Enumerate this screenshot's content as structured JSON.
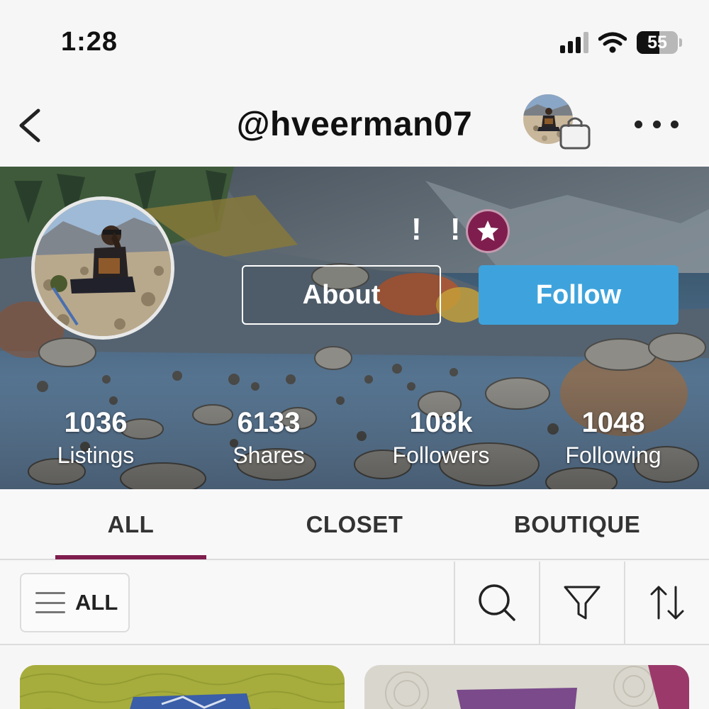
{
  "status_bar": {
    "time": "1:28",
    "battery_level": "55",
    "signal_bars_active": 3,
    "signal_bars_total": 4
  },
  "header": {
    "username": "@hveerman07",
    "icons": {
      "back": "chevron-left-icon",
      "bag": "shopping-bag-icon",
      "more": "more-horizontal-icon"
    }
  },
  "profile": {
    "exclamation_marks": "! !",
    "badge_icon": "star-icon",
    "about_label": "About",
    "follow_label": "Follow",
    "stats": [
      {
        "value": "1036",
        "label": "Listings"
      },
      {
        "value": "6133",
        "label": "Shares"
      },
      {
        "value": "108k",
        "label": "Followers"
      },
      {
        "value": "1048",
        "label": "Following"
      }
    ]
  },
  "tabs": [
    {
      "label": "ALL",
      "active": true
    },
    {
      "label": "CLOSET",
      "active": false
    },
    {
      "label": "BOUTIQUE",
      "active": false
    }
  ],
  "filter_bar": {
    "category_label": "ALL",
    "icons": {
      "search": "search-icon",
      "filter": "filter-icon",
      "sort": "sort-icon"
    }
  },
  "colors": {
    "accent": "#7f1e4e",
    "follow_button": "#3ea3dc",
    "background": "#f7f6f6"
  }
}
